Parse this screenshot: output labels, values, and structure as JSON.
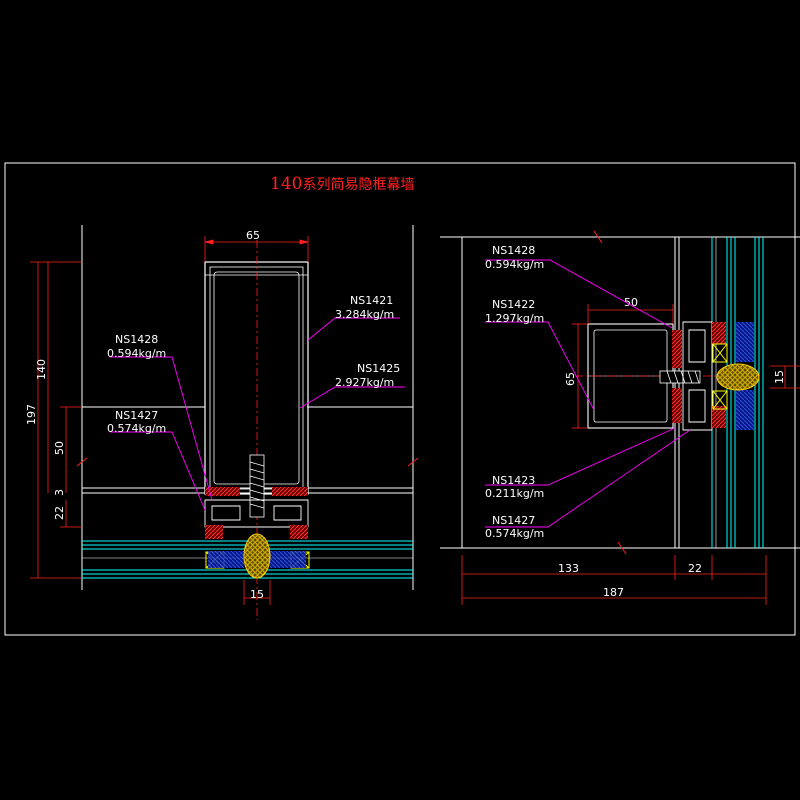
{
  "title": {
    "number": "140",
    "text": "系列简易隐框幕墙"
  },
  "left_view": {
    "dims": {
      "top_width": "65",
      "total_height": "197",
      "height_140": "140",
      "height_50": "50",
      "gap_3": "3",
      "height_22": "22",
      "bottom_width": "15"
    },
    "labels": [
      {
        "code": "NS1421",
        "weight": "3.284kg/m"
      },
      {
        "code": "NS1425",
        "weight": "2.927kg/m"
      },
      {
        "code": "NS1428",
        "weight": "0.594kg/m"
      },
      {
        "code": "NS1427",
        "weight": "0.574kg/m"
      }
    ]
  },
  "right_view": {
    "dims": {
      "width_50": "50",
      "height_65": "65",
      "width_15": "15",
      "width_133": "133",
      "width_22": "22",
      "width_187": "187"
    },
    "labels": [
      {
        "code": "NS1428",
        "weight": "0.594kg/m"
      },
      {
        "code": "NS1422",
        "weight": "1.297kg/m"
      },
      {
        "code": "NS1423",
        "weight": "0.211kg/m"
      },
      {
        "code": "NS1427",
        "weight": "0.574kg/m"
      }
    ]
  },
  "colors": {
    "background": "#000000",
    "frame": "#ffffff",
    "dimension": "#ff2020",
    "leader": "#ff00ff",
    "glass": "#00ffff",
    "spacer": "#ffff00",
    "gasket": "#cc2020",
    "seal": "#2040ff"
  }
}
